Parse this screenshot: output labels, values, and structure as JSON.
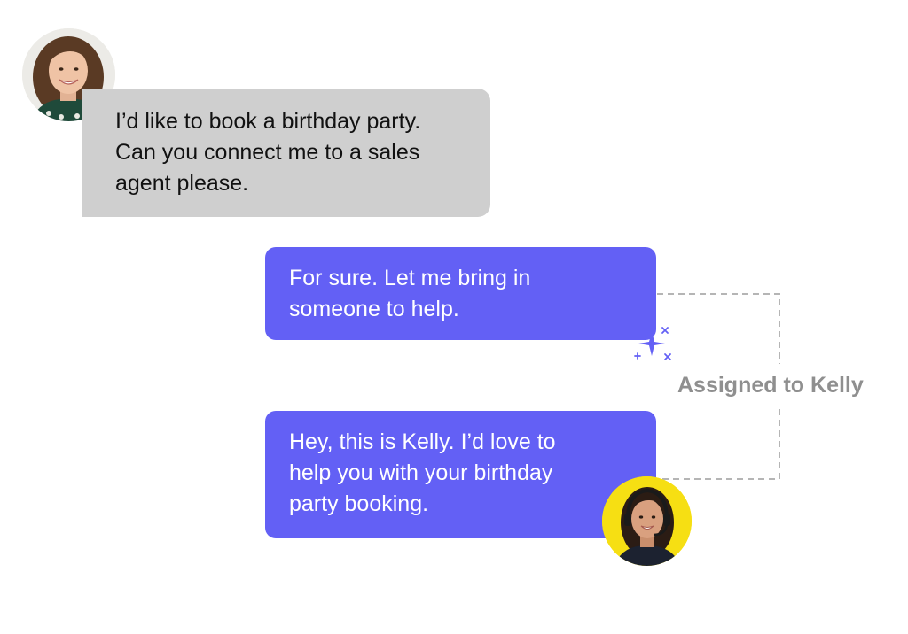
{
  "conversation": {
    "customer_message": {
      "lines": [
        "I’d like to book a birthday party.",
        "Can you connect me to a sales",
        "agent please."
      ]
    },
    "bot_message": {
      "lines": [
        "For sure. Let me bring in",
        "someone to help."
      ]
    },
    "agent_message": {
      "lines": [
        "Hey, this is Kelly. I’d love to",
        "help you with your birthday",
        "party booking."
      ]
    },
    "assignment_label": "Assigned to Kelly"
  },
  "colors": {
    "customer_bubble": "#cfcfcf",
    "agent_bubble": "#6360f5",
    "agent_avatar_bg": "#f6df13",
    "label": "#8f8f8f",
    "connector": "#b5b5b5"
  },
  "icons": {
    "customer_avatar": "woman-avatar",
    "agent_avatar": "headset-agent-avatar",
    "handoff": "sparkle-icon"
  }
}
